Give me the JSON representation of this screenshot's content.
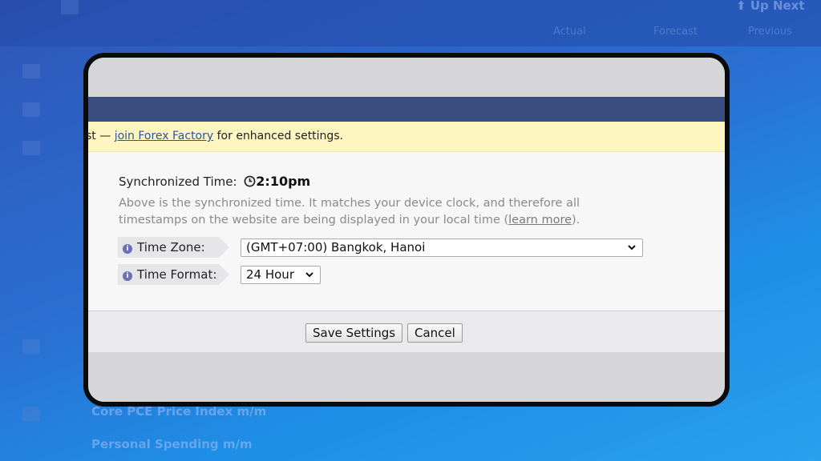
{
  "background": {
    "header_link": "Up Next",
    "columns": [
      "Actual",
      "Forecast",
      "Previous"
    ],
    "rows": [
      "Core PCE Price Index m/m",
      "Personal Spending m/m"
    ]
  },
  "notice": {
    "prefix": "st —",
    "link": "join Forex Factory",
    "suffix": "for enhanced settings."
  },
  "sync": {
    "label": "Synchronized Time:",
    "time": "2:10pm",
    "description_1": "Above is the synchronized time. It matches your device clock, and therefore all",
    "description_2": "timestamps on the website are being displayed in your local time (",
    "learn_more": "learn more",
    "description_end": ")."
  },
  "timezone": {
    "label": "Time Zone:",
    "value": "(GMT+07:00) Bangkok, Hanoi"
  },
  "timeformat": {
    "label": "Time Format:",
    "value": "24 Hour"
  },
  "buttons": {
    "save": "Save Settings",
    "cancel": "Cancel"
  },
  "colors": {
    "navy_bar": "#3a4e82",
    "notice_bg": "#fdf6c1",
    "link": "#2f52a0",
    "backdrop": "#2a6fd2"
  }
}
